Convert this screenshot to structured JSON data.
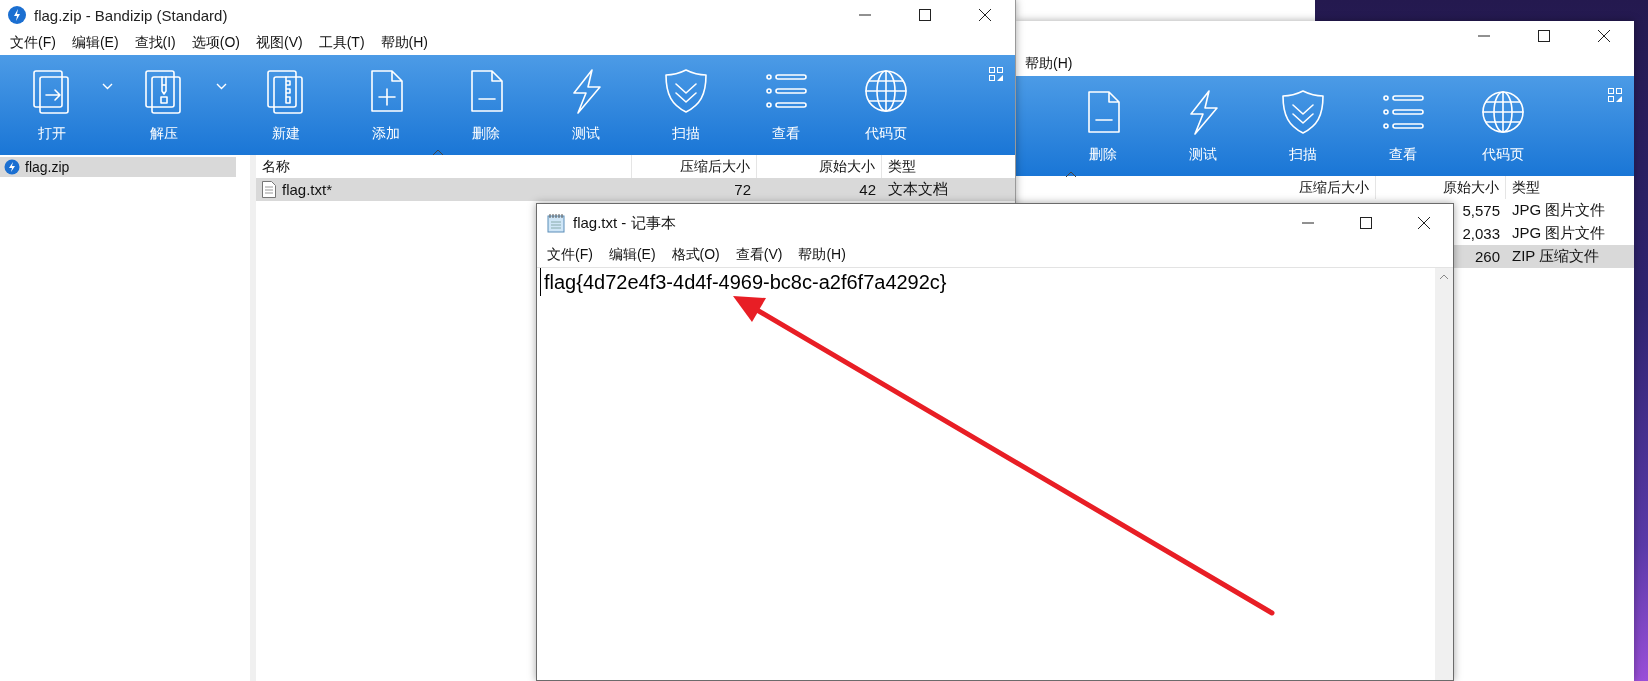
{
  "bandizip": {
    "title": "flag.zip - Bandizip (Standard)",
    "menu": [
      "文件(F)",
      "编辑(E)",
      "查找(I)",
      "选项(O)",
      "视图(V)",
      "工具(T)",
      "帮助(H)"
    ],
    "toolbar": [
      {
        "label": "打开",
        "kind": "open",
        "dropdown": true
      },
      {
        "label": "解压",
        "kind": "extract",
        "dropdown": true
      },
      {
        "label": "新建",
        "kind": "new",
        "dropdown": false
      },
      {
        "label": "添加",
        "kind": "add",
        "dropdown": false
      },
      {
        "label": "删除",
        "kind": "delete",
        "dropdown": false
      },
      {
        "label": "测试",
        "kind": "test",
        "dropdown": false
      },
      {
        "label": "扫描",
        "kind": "scan",
        "dropdown": false
      },
      {
        "label": "查看",
        "kind": "view",
        "dropdown": false
      },
      {
        "label": "代码页",
        "kind": "codepage",
        "dropdown": false
      }
    ],
    "sidebar": {
      "items": [
        {
          "label": "flag.zip",
          "selected": true
        }
      ]
    },
    "list": {
      "columns": [
        "名称",
        "压缩后大小",
        "原始大小",
        "类型"
      ],
      "rows": [
        {
          "name": "flag.txt*",
          "compressed": "72",
          "original": "42",
          "type": "文本文档",
          "selected": true
        }
      ]
    }
  },
  "back_window": {
    "menu": [
      "帮助(H)"
    ],
    "toolbar": [
      {
        "label": "删除",
        "kind": "delete"
      },
      {
        "label": "测试",
        "kind": "test"
      },
      {
        "label": "扫描",
        "kind": "scan"
      },
      {
        "label": "查看",
        "kind": "view"
      },
      {
        "label": "代码页",
        "kind": "codepage"
      }
    ],
    "list": {
      "columns": [
        "压缩后大小",
        "原始大小",
        "类型"
      ],
      "rows": [
        {
          "original": "5,575",
          "type": "JPG 图片文件",
          "selected": false
        },
        {
          "original": "2,033",
          "type": "JPG 图片文件",
          "selected": false
        },
        {
          "original": "260",
          "type": "ZIP 压缩文件",
          "selected": true
        }
      ]
    }
  },
  "notepad": {
    "title": "flag.txt - 记事本",
    "menu": [
      "文件(F)",
      "编辑(E)",
      "格式(O)",
      "查看(V)",
      "帮助(H)"
    ],
    "content": "flag{4d72e4f3-4d4f-4969-bc8c-a2f6f7a4292c}"
  }
}
